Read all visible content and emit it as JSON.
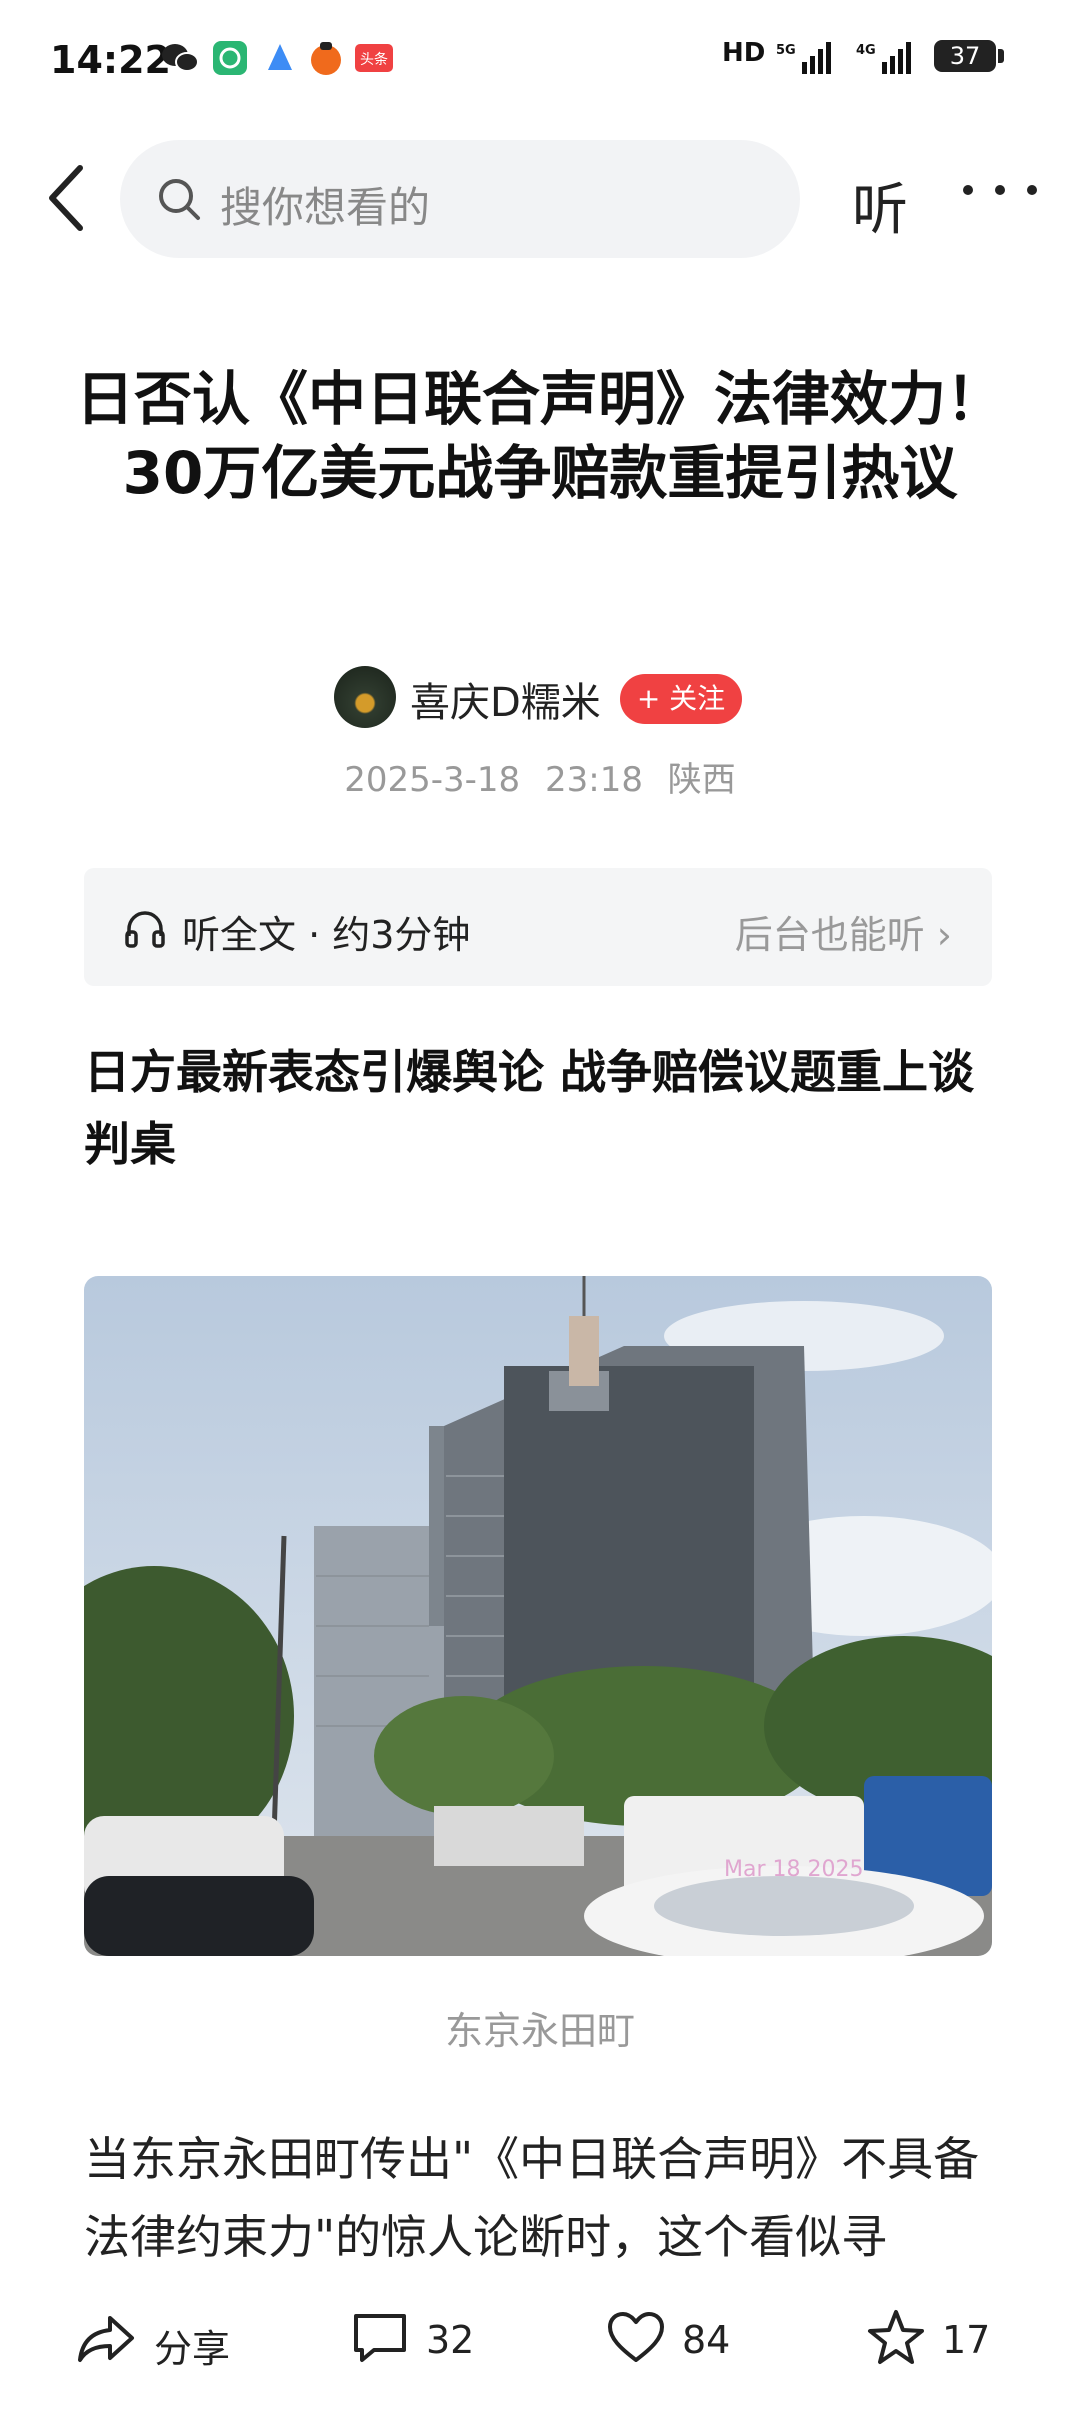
{
  "status_bar": {
    "time": "14:22",
    "hd_label": "HD",
    "net1": "5G",
    "net2": "4G",
    "battery": "37"
  },
  "nav": {
    "search_placeholder": "搜你想看的",
    "listen_label": "听"
  },
  "article": {
    "title": "日否认《中日联合声明》法律效力！30万亿美元战争赔款重提引热议",
    "author": "喜庆D糯米",
    "follow_label": "+ 关注",
    "date": "2025-3-18",
    "time": "23:18",
    "location": "陕西",
    "listen_full": "听全文 · 约3分钟",
    "listen_background": "后台也能听 ›",
    "subtitle": "日方最新表态引爆舆论 战争赔偿议题重上谈判桌",
    "image_caption": "东京永田町",
    "photo_watermark": "Mar 18 2025",
    "body_text": "当东京永田町传出\"《中日联合声明》不具备法律约束力\"的惊人论断时，这个看似寻"
  },
  "bottom_bar": {
    "share_label": "分享",
    "comments_count": "32",
    "likes_count": "84",
    "favorites_count": "17"
  },
  "colors": {
    "accent": "#f04142",
    "secondary_text": "#999999",
    "search_bg": "#f2f3f5"
  }
}
